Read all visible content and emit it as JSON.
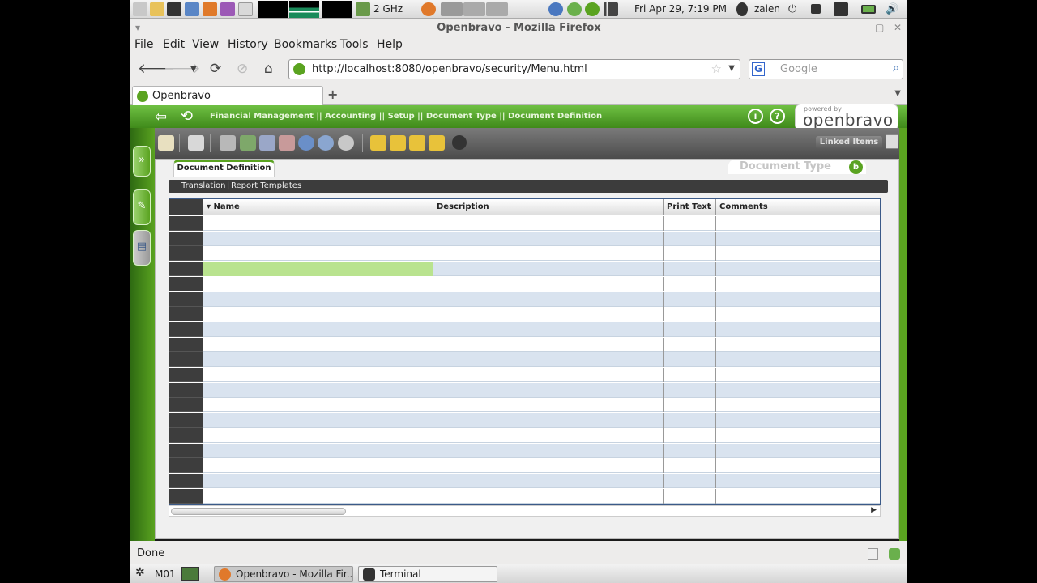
{
  "top_panel": {
    "cpu_freq": "2 GHz",
    "datetime": "Fri Apr 29,  7:19 PM",
    "user": "zaien"
  },
  "window": {
    "title": "Openbravo - Mozilla Firefox"
  },
  "menubar": [
    "File",
    "Edit",
    "View",
    "History",
    "Bookmarks",
    "Tools",
    "Help"
  ],
  "navbar": {
    "url": "http://localhost:8080/openbravo/security/Menu.html",
    "search_placeholder": "Google"
  },
  "tab": {
    "label": "Openbravo"
  },
  "app": {
    "breadcrumb": "Financial Management || Accounting || Setup || Document Type  ||  Document Definition",
    "logo_powered": "powered by",
    "logo_name": "openbravo",
    "linked_items": "Linked Items",
    "doc_tab": "Document Definition",
    "doc_type": "Document Type",
    "subtabs": [
      "Translation",
      "Report Templates"
    ],
    "columns": [
      "Name",
      "Description",
      "Print Text",
      "Comments"
    ],
    "sort_marker": "▾"
  },
  "status": {
    "text": "Done"
  },
  "taskbar": {
    "workspace": "M01",
    "items": [
      "Openbravo - Mozilla Fir...",
      "Terminal"
    ]
  }
}
